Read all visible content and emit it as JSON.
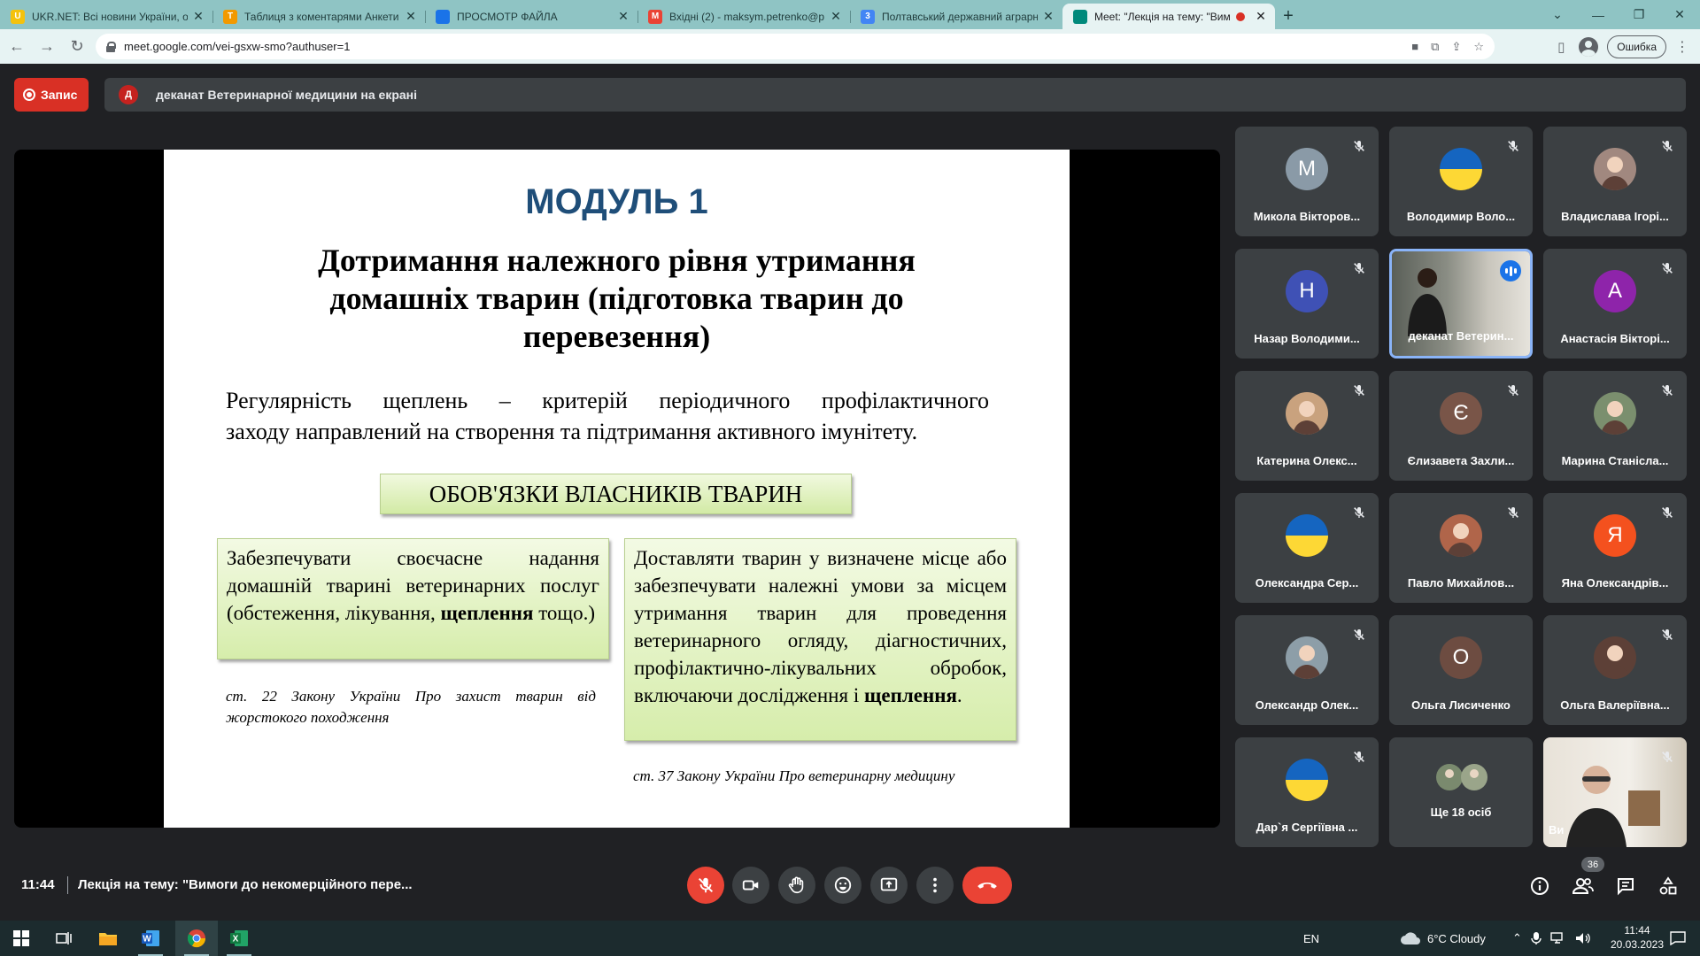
{
  "browser": {
    "tabs": [
      {
        "title": "UKR.NET: Всі новини України, ос",
        "favicon_color": "#f4c20d",
        "active": false,
        "recording": false
      },
      {
        "title": "Таблиця з коментарями Анкети",
        "favicon_color": "#f29900",
        "active": false,
        "recording": false
      },
      {
        "title": "ПРОСМОТР ФАЙЛА",
        "favicon_color": "#1a73e8",
        "active": false,
        "recording": false
      },
      {
        "title": "Вхідні (2) - maksym.petrenko@p",
        "favicon_color": "#ea4335",
        "active": false,
        "recording": false
      },
      {
        "title": "Полтавський державний аграрн",
        "favicon_color": "#4285f4",
        "active": false,
        "recording": false
      },
      {
        "title": "Meet: \"Лекція на тему: \"Вим",
        "favicon_color": "#00897b",
        "active": true,
        "recording": true
      }
    ],
    "favicon_glyphs": [
      "U",
      "Т",
      "",
      "M",
      "3",
      ""
    ],
    "url": "meet.google.com/vei-gsxw-smo?authuser=1",
    "profile_error": "Ошибка"
  },
  "meet": {
    "record_label": "Запис",
    "presenter_avatar": "Д",
    "presenter_banner": "деканат Ветеринарної медицини на екрані"
  },
  "slide": {
    "module": "МОДУЛЬ 1",
    "heading": "Дотримання належного рівня утримання домашніх тварин (підготовка тварин до перевезення)",
    "paragraph_line1": "Регулярність щеплень – критерій періодичного профілактичного",
    "paragraph_line2": "заходу направлений на створення та підтримання активного імунітету.",
    "banner": "ОБОВ'ЯЗКИ ВЛАСНИКІВ ТВАРИН",
    "box1": {
      "text": "Забезпечувати своєчасне надання домашній тварині ветеринарних послуг (обстеження, лікування,",
      "bold": "щеплення",
      "tail": " тощо.)"
    },
    "box2": {
      "text": "Доставляти тварин у визначене місце або забезпечувати належні умови за місцем утримання тварин для проведення ветеринарного огляду, діагностичних, профілактично-лікувальних обробок, включаючи дослідження і",
      "bold": "щеплення",
      "tail": "."
    },
    "cite1": "ст. 22 Закону України Про захист тварин від жорстокого походження",
    "cite2": "ст. 37 Закону України Про ветеринарну медицину"
  },
  "participants": [
    {
      "name": "Микола Вікторов...",
      "initial": "М",
      "avatar_color": "#8a9aa7",
      "kind": "letter",
      "muted": true
    },
    {
      "name": "Володимир Воло...",
      "initial": "",
      "avatar_color": "#1565c0",
      "kind": "flag",
      "muted": true
    },
    {
      "name": "Владислава Ігорі...",
      "initial": "",
      "avatar_color": "#a1887f",
      "kind": "photo",
      "muted": true
    },
    {
      "name": "Назар Володими...",
      "initial": "Н",
      "avatar_color": "#3f51b5",
      "kind": "letter",
      "muted": true
    },
    {
      "name": "деканат Ветерин...",
      "initial": "",
      "avatar_color": "#6d7b7b",
      "kind": "video",
      "muted": false,
      "speaking": true
    },
    {
      "name": "Анастасія Вікторі...",
      "initial": "А",
      "avatar_color": "#8e24aa",
      "kind": "letter",
      "muted": true
    },
    {
      "name": "Катерина Олекс...",
      "initial": "",
      "avatar_color": "#c9a27e",
      "kind": "photo",
      "muted": true
    },
    {
      "name": "Єлизавета Захли...",
      "initial": "Є",
      "avatar_color": "#795548",
      "kind": "letter",
      "muted": true
    },
    {
      "name": "Марина Станісла...",
      "initial": "",
      "avatar_color": "#7b8f6e",
      "kind": "photo",
      "muted": true
    },
    {
      "name": "Олександра Сер...",
      "initial": "",
      "avatar_color": "#1565c0",
      "kind": "flag",
      "muted": true
    },
    {
      "name": "Павло Михайлов...",
      "initial": "",
      "avatar_color": "#b0654a",
      "kind": "photo",
      "muted": true
    },
    {
      "name": "Яна Олександрів...",
      "initial": "Я",
      "avatar_color": "#f4511e",
      "kind": "letter",
      "muted": true
    },
    {
      "name": "Олександр Олек...",
      "initial": "",
      "avatar_color": "#8d9ea8",
      "kind": "photo",
      "muted": true
    },
    {
      "name": "Ольга Лисиченко",
      "initial": "О",
      "avatar_color": "#6d4c41",
      "kind": "letter",
      "muted": false
    },
    {
      "name": "Ольга Валеріївна...",
      "initial": "",
      "avatar_color": "#5d4037",
      "kind": "photo",
      "muted": true
    },
    {
      "name": "Дар`я Сергіївна ...",
      "initial": "",
      "avatar_color": "#1565c0",
      "kind": "flag",
      "muted": true
    },
    {
      "name": "Ще 18 осіб",
      "initial": "",
      "avatar_color": "#7a8a6e",
      "kind": "more",
      "muted": false
    },
    {
      "name": "Ви",
      "initial": "",
      "avatar_color": "#e8e2d8",
      "kind": "self",
      "muted": true
    }
  ],
  "bottom": {
    "time": "11:44",
    "separator": "|",
    "meeting_title": "Лекція на тему: \"Вимоги до некомерційного пере...",
    "people_count": "36"
  },
  "taskbar": {
    "language": "EN",
    "weather": "6°C  Cloudy",
    "time": "11:44",
    "date": "20.03.2023"
  },
  "colors": {
    "meet_bg": "#202124",
    "tile_bg": "#3c4043",
    "danger": "#ea4335",
    "module_blue": "#1f4e79",
    "slide_green": "#d6edab"
  }
}
